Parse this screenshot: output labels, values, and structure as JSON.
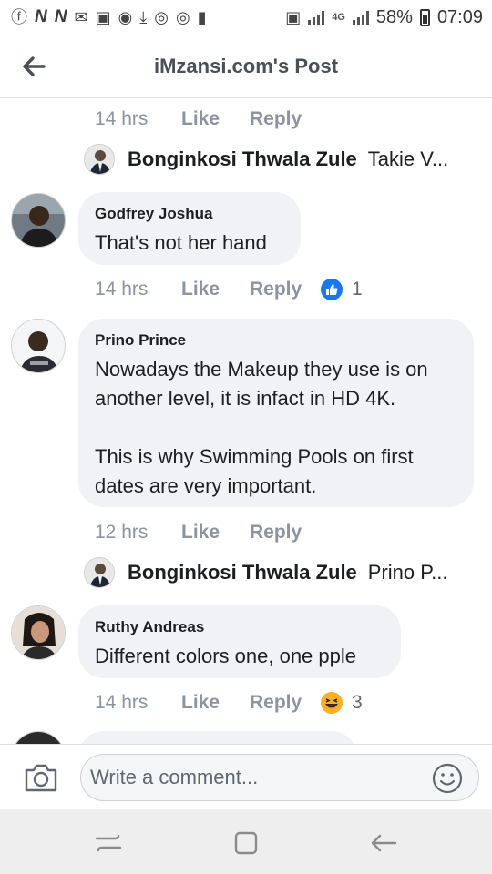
{
  "status_bar": {
    "network": "4G",
    "battery": "58%",
    "time": "07:09"
  },
  "header": {
    "title": "iMzansi.com's Post",
    "back_icon": "back-arrow-icon"
  },
  "comments": [
    {
      "kind": "meta",
      "time": "14 hrs",
      "like": "Like",
      "reply": "Reply"
    },
    {
      "kind": "reply_preview",
      "name": "Bonginkosi Thwala Zule",
      "snippet": "Takie V..."
    },
    {
      "kind": "comment",
      "author": "Godfrey Joshua",
      "text": "That's not her hand",
      "time": "14 hrs",
      "like": "Like",
      "reply": "Reply",
      "reaction_icon": "like-reaction-icon",
      "reaction_count": "1"
    },
    {
      "kind": "comment",
      "author": "Prino Prince",
      "text": "Nowadays the Makeup they use is on\nanother level, it is infact in HD 4K.\n\nThis is why Swimming Pools on first\ndates are very important.",
      "time": "12 hrs",
      "like": "Like",
      "reply": "Reply"
    },
    {
      "kind": "reply_preview",
      "name": "Bonginkosi Thwala Zule",
      "snippet": "Prino P..."
    },
    {
      "kind": "comment",
      "author": "Ruthy Andreas",
      "text": "Different colors one, one pple",
      "time": "14 hrs",
      "like": "Like",
      "reply": "Reply",
      "reaction_icon": "haha-reaction-icon",
      "reaction_count": "3"
    }
  ],
  "composer": {
    "placeholder": "Write a comment..."
  },
  "colors": {
    "facebook_blue": "#1877f2",
    "bubble_bg": "#f0f2f5",
    "meta_gray": "#8d949e",
    "haha_yellow": "#f7b125"
  }
}
